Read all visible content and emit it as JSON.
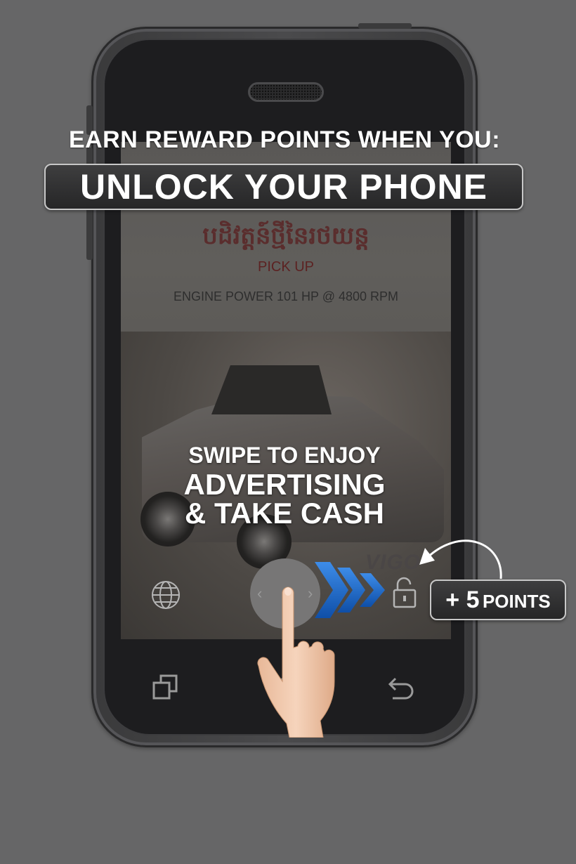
{
  "overlay": {
    "headline": "EARN REWARD POINTS WHEN YOU:",
    "unlock_label": "UNLOCK YOUR PHONE",
    "swipe_line1": "SWIPE TO ENJOY",
    "swipe_line2": "ADVERTISING",
    "swipe_line3": "& TAKE CASH",
    "points_plus": "+ 5",
    "points_label": "POINTS"
  },
  "ad": {
    "khmer_title": "បដិវត្តន៍ថ្មីនៃរថយន្ត",
    "subtitle": "PICK UP",
    "engine": "ENGINE POWER  101 HP @ 4800 RPM",
    "brand": "VIGO"
  },
  "lockscreen": {
    "left_chevron": "‹",
    "right_chevron": "›"
  },
  "icons": {
    "globe": "globe-icon",
    "lock": "unlock-icon",
    "recent": "recent-apps-icon",
    "home": "home-icon",
    "back": "back-icon",
    "swipe_arrows": "chevron-right-icon",
    "hand": "hand-pointer-icon"
  },
  "colors": {
    "background": "#666667",
    "chevron_blue": "#1f6fd1",
    "ad_title": "#5a2d2d"
  }
}
